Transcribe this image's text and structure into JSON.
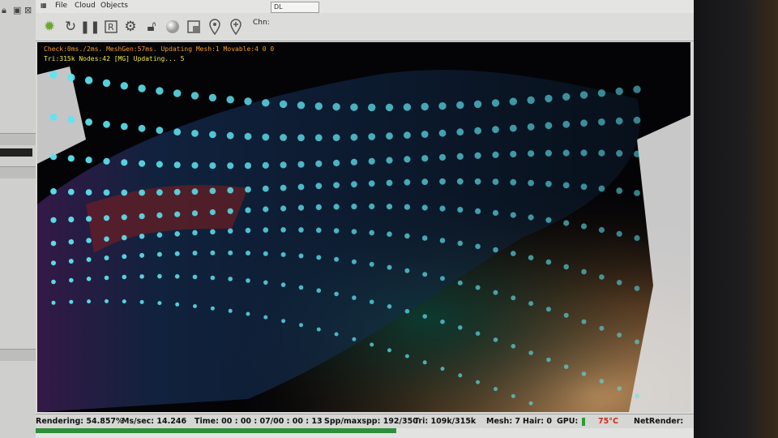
{
  "menu": {
    "file": "File",
    "cloud": "Cloud",
    "objects": "Objects"
  },
  "toolbar": {
    "icons": [
      "sun-icon",
      "refresh-icon",
      "pause-icon",
      "render-r-icon",
      "gear-icon",
      "lock-icon",
      "sphere-icon",
      "region-icon",
      "pin-icon",
      "pin-settings-icon"
    ],
    "channel_label": "Chn:",
    "channel_value": "DL"
  },
  "hud": {
    "line1": "Check:0ms./2ms. MeshGen:57ms. Updating Mesh:1 Movable:4  0 0",
    "line2": "Tri:315k Nodes:42 [MG] Updating...   5"
  },
  "status": {
    "rendering": "Rendering: 54.857%",
    "mssec": "Ms/sec: 14.246",
    "time": "Time: 00 : 00 : 07/00 : 00 : 13",
    "spp": "Spp/maxspp: 192/350",
    "tri": "Tri: 109k/315k",
    "mesh": "Mesh: 7",
    "hair": "Hair: 0",
    "gpu": "GPU:",
    "temp": "75°C",
    "net": "NetRender:"
  },
  "progress": {
    "value": 0.54857
  },
  "colors": {
    "hud_orange": "#f29a2a",
    "hud_yellow": "#f2ea3a",
    "temp_red": "#cc2a1a",
    "dots": "#5fe4f0"
  }
}
